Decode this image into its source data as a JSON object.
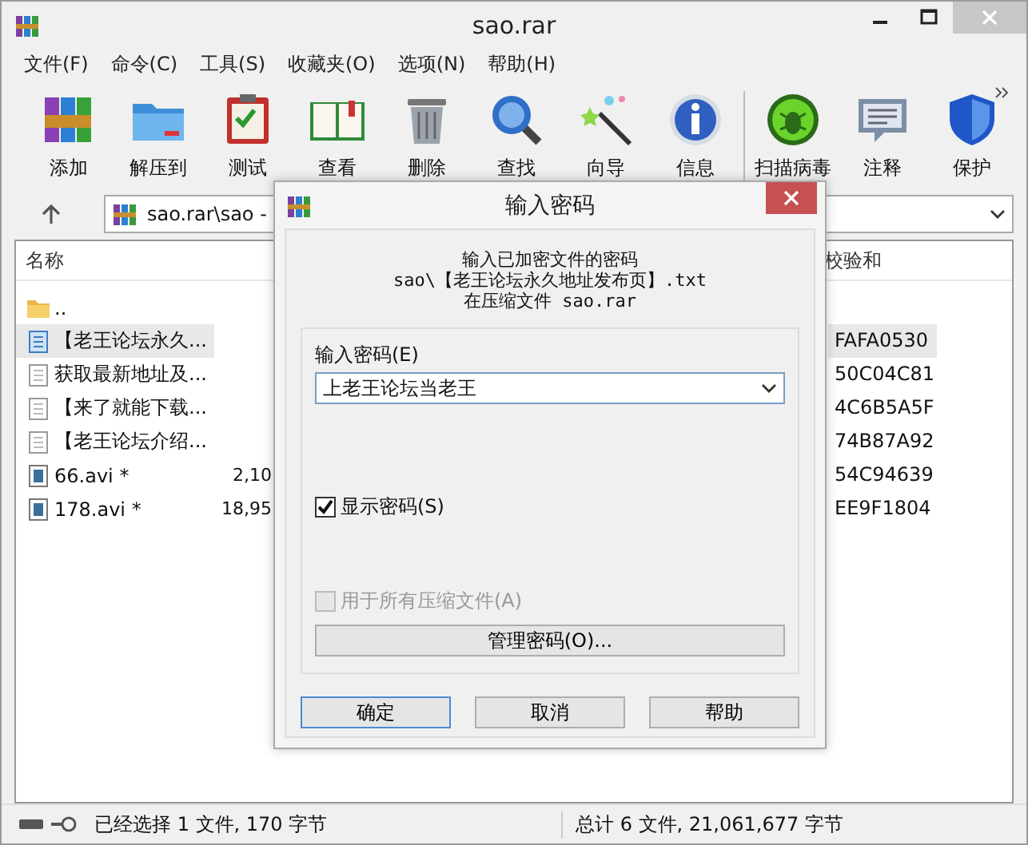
{
  "window": {
    "title": "sao.rar"
  },
  "menu": [
    "文件(F)",
    "命令(C)",
    "工具(S)",
    "收藏夹(O)",
    "选项(N)",
    "帮助(H)"
  ],
  "toolbar": [
    {
      "label": "添加",
      "kind": "add"
    },
    {
      "label": "解压到",
      "kind": "extract"
    },
    {
      "label": "测试",
      "kind": "test"
    },
    {
      "label": "查看",
      "kind": "view"
    },
    {
      "label": "删除",
      "kind": "delete"
    },
    {
      "label": "查找",
      "kind": "find"
    },
    {
      "label": "向导",
      "kind": "wizard"
    },
    {
      "label": "信息",
      "kind": "info"
    },
    {
      "label": "扫描病毒",
      "kind": "virus"
    },
    {
      "label": "注释",
      "kind": "comment"
    },
    {
      "label": "保护",
      "kind": "protect"
    }
  ],
  "address": {
    "path": "sao.rar\\sao -"
  },
  "file_list": {
    "columns": [
      "名称",
      "校验和"
    ],
    "rows": [
      {
        "name": "..",
        "size": "",
        "checksum": "",
        "kind": "folder",
        "selected": false
      },
      {
        "name": "【老王论坛永久...",
        "size": "",
        "checksum": "FAFA0530",
        "kind": "textblue",
        "selected": true
      },
      {
        "name": "获取最新地址及...",
        "size": "",
        "checksum": "50C04C81",
        "kind": "text",
        "selected": false
      },
      {
        "name": "【来了就能下载...",
        "size": "",
        "checksum": "4C6B5A5F",
        "kind": "text",
        "selected": false
      },
      {
        "name": "【老王论坛介绍...",
        "size": "",
        "checksum": "74B87A92",
        "kind": "text",
        "selected": false
      },
      {
        "name": "66.avi *",
        "size": "2,10",
        "checksum": "54C94639",
        "kind": "video",
        "selected": false
      },
      {
        "name": "178.avi *",
        "size": "18,95",
        "checksum": "EE9F1804",
        "kind": "video",
        "selected": false
      }
    ]
  },
  "status_bar": {
    "left": "已经选择 1 文件, 170 字节",
    "right": "总计 6 文件, 21,061,677 字节"
  },
  "dialog": {
    "title": "输入密码",
    "message": [
      "输入已加密文件的密码",
      "sao\\【老王论坛永久地址发布页】.txt",
      "在压缩文件 sao.rar"
    ],
    "password_label": "输入密码(E)",
    "password_value": "上老王论坛当老王",
    "checkboxes": [
      {
        "label": "显示密码(S)",
        "checked": true,
        "disabled": false
      },
      {
        "label": "用于所有压缩文件(A)",
        "checked": false,
        "disabled": true
      }
    ],
    "manage_button": "管理密码(O)...",
    "buttons": [
      {
        "label": "确定",
        "default": true
      },
      {
        "label": "取消",
        "default": false
      },
      {
        "label": "帮助",
        "default": false
      }
    ]
  }
}
